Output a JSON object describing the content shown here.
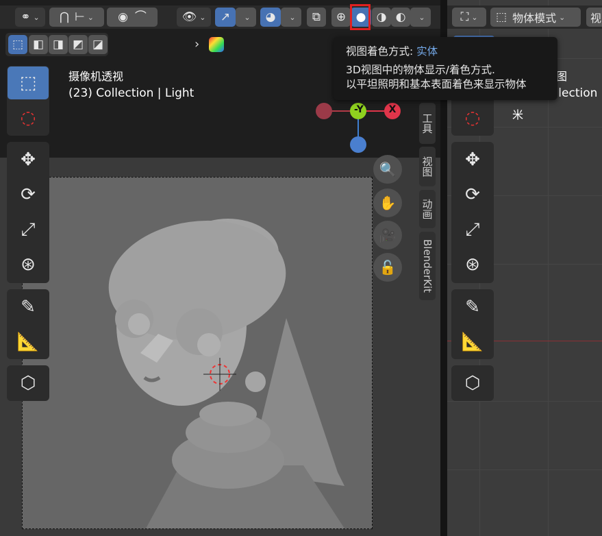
{
  "left_viewport": {
    "view_name": "摄像机透视",
    "collection_info": "(23) Collection | Light",
    "sidebar_tabs": [
      "工具",
      "视图",
      "动画",
      "BlenderKit"
    ],
    "gizmo": {
      "y_label": "-Y",
      "x_label": "X"
    }
  },
  "right_viewport": {
    "mode_label": "物体模式",
    "view_name": "正交顶视图",
    "collection_info": "(23) Collection",
    "unit_label": "米",
    "cut_button": "视"
  },
  "tooltip": {
    "title_prefix": "视图着色方式: ",
    "title_value": "实体",
    "line1": "3D视图中的物体显示/着色方式.",
    "line2": "以平坦照明和基本表面着色来显示物体"
  },
  "icons": {
    "link": "link-icon",
    "magnet": "magnet-icon",
    "proportional": "proportional-edit-icon",
    "visibility": "eye-icon",
    "gizmo": "gizmo-icon",
    "overlay": "overlay-icon",
    "xray": "xray-icon",
    "wireframe": "wireframe-shading-icon",
    "solid": "solid-shading-icon",
    "material": "material-shading-icon",
    "rendered": "rendered-shading-icon"
  },
  "colors": {
    "accent": "#4772b3",
    "highlight_box": "#e02020",
    "x_axis": "#e0354a",
    "y_axis": "#8fd11f",
    "z_axis": "#3f7fd0"
  }
}
